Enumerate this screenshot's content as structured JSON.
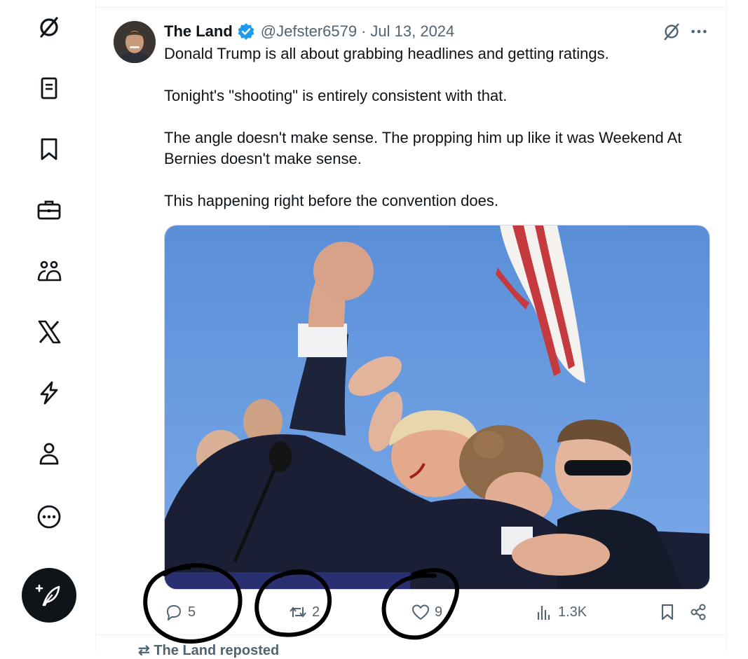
{
  "sidebar": {
    "items": [
      {
        "icon": "grok-icon"
      },
      {
        "icon": "lists-icon"
      },
      {
        "icon": "bookmark-icon"
      },
      {
        "icon": "jobs-briefcase-icon"
      },
      {
        "icon": "communities-icon"
      },
      {
        "icon": "x-logo-icon"
      },
      {
        "icon": "verified-orgs-bolt-icon"
      },
      {
        "icon": "profile-icon"
      },
      {
        "icon": "more-icon"
      }
    ],
    "compose": {
      "icon": "compose-feather-icon"
    }
  },
  "post": {
    "author_name": "The Land",
    "handle": "@Jefster6579",
    "separator": "·",
    "date": "Jul 13, 2024",
    "paragraphs": [
      "Donald Trump is all about grabbing headlines and getting ratings.",
      "Tonight's \"shooting\" is entirely consistent with that.",
      "The angle doesn't make sense. The propping him up like it was Weekend At Bernies doesn't make sense.",
      "This happening right before the convention does."
    ],
    "media": {
      "icon": "photo-image"
    },
    "stats": {
      "replies": "5",
      "reposts": "2",
      "likes": "9",
      "views": "1.3K"
    }
  },
  "next_item": {
    "label": "The Land reposted"
  },
  "colors": {
    "accent": "#1d9bf0",
    "text": "#0f1419",
    "muted": "#536471"
  }
}
